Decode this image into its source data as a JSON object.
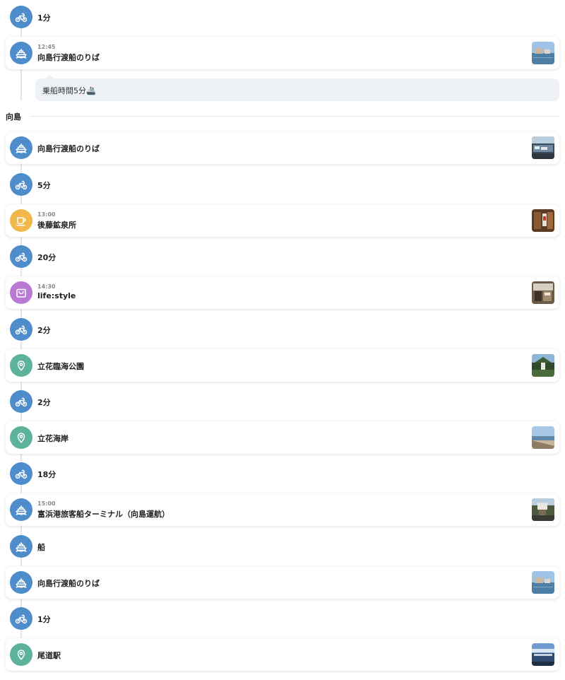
{
  "colors": {
    "transport": "#4f8ccc",
    "cafe": "#f2b84a",
    "shop": "#b97ad6",
    "place": "#5cb29a",
    "line": "#e3e6ea"
  },
  "section_label": "向島",
  "ferry_note": "乗船時間5分🚢",
  "items": [
    {
      "kind": "move",
      "icon": "bicycle-icon",
      "label": "1分"
    },
    {
      "kind": "card",
      "icon": "ferry-icon",
      "time": "12:45",
      "title": "向島行渡船のりば",
      "thumb": "harbor"
    },
    {
      "kind": "card",
      "icon": "ferry-icon",
      "time": "",
      "title": "向島行渡船のりば",
      "thumb": "pier"
    },
    {
      "kind": "move",
      "icon": "bicycle-icon",
      "label": "5分"
    },
    {
      "kind": "card",
      "icon": "cup-icon",
      "time": "13:00",
      "title": "後藤鉱泉所",
      "thumb": "shop"
    },
    {
      "kind": "move",
      "icon": "bicycle-icon",
      "label": "20分"
    },
    {
      "kind": "card",
      "icon": "bag-icon",
      "time": "14:30",
      "title": "life:style",
      "thumb": "store"
    },
    {
      "kind": "move",
      "icon": "bicycle-icon",
      "label": "2分"
    },
    {
      "kind": "card",
      "icon": "pin-icon",
      "time": "",
      "title": "立花臨海公園",
      "thumb": "park"
    },
    {
      "kind": "move",
      "icon": "bicycle-icon",
      "label": "2分"
    },
    {
      "kind": "card",
      "icon": "pin-icon",
      "time": "",
      "title": "立花海岸",
      "thumb": "beach"
    },
    {
      "kind": "move",
      "icon": "bicycle-icon",
      "label": "18分"
    },
    {
      "kind": "card",
      "icon": "ferry-icon",
      "time": "15:00",
      "title": "富浜港旅客船ターミナル（向島運航）",
      "thumb": "terminal"
    },
    {
      "kind": "move",
      "icon": "ferry-icon",
      "label": "船"
    },
    {
      "kind": "card",
      "icon": "ferry-icon",
      "time": "",
      "title": "向島行渡船のりば",
      "thumb": "harbor"
    },
    {
      "kind": "move",
      "icon": "bicycle-icon",
      "label": "1分"
    },
    {
      "kind": "card",
      "icon": "pin-icon",
      "time": "",
      "title": "尾道駅",
      "thumb": "station"
    }
  ]
}
